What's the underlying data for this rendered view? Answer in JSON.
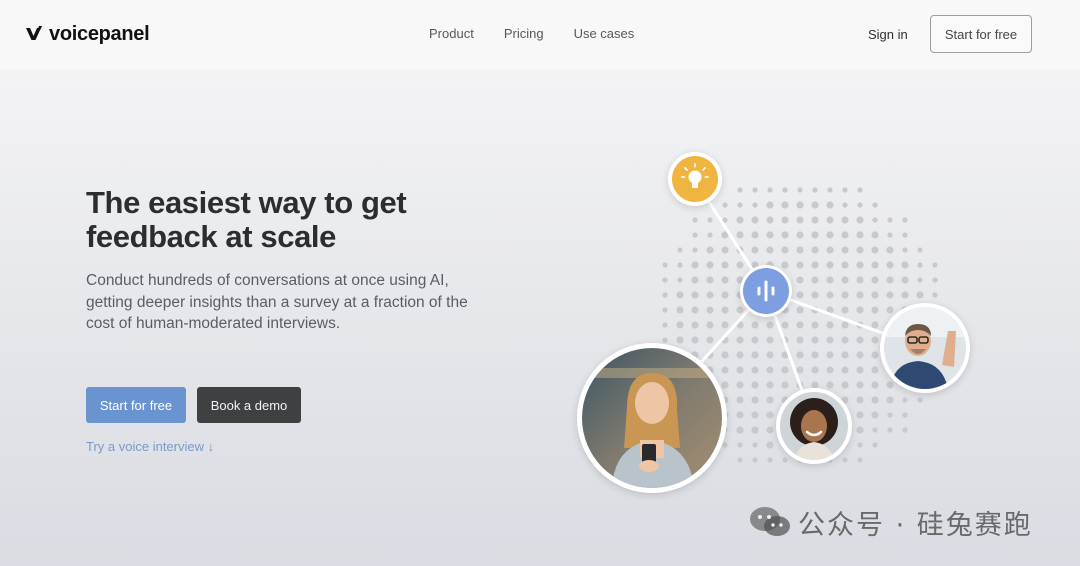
{
  "header": {
    "logo_text": "voicepanel",
    "logo_icon": "voicepanel-logo-icon",
    "nav": [
      {
        "label": "Product"
      },
      {
        "label": "Pricing"
      },
      {
        "label": "Use cases"
      }
    ],
    "sign_in": "Sign in",
    "cta": "Start for free"
  },
  "hero": {
    "title": "The easiest way to get feedback at scale",
    "subtitle": "Conduct hundreds of conversations at once using AI, getting deeper insights than a survey at a fraction of the cost of human-moderated interviews.",
    "primary_button": "Start for free",
    "secondary_button": "Book a demo",
    "voice_link": "Try a voice interview ↓"
  },
  "illustration": {
    "icons": [
      "lightbulb-icon",
      "voice-waveform-icon"
    ],
    "colors": {
      "lightbulb_bg": "#f0b541",
      "voice_bg": "#7d9ee0",
      "dots": "#c7c9cd"
    }
  },
  "watermark": {
    "text": "公众号 · 硅兔赛跑",
    "icon": "wechat-icon"
  }
}
